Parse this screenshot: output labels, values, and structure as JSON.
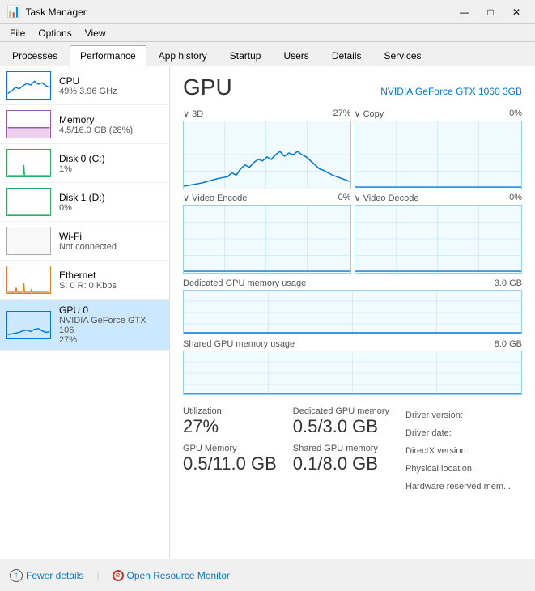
{
  "titleBar": {
    "title": "Task Manager",
    "minimize": "—",
    "maximize": "□",
    "close": "✕"
  },
  "menuBar": {
    "items": [
      "File",
      "Options",
      "View"
    ]
  },
  "tabs": {
    "items": [
      "Processes",
      "Performance",
      "App history",
      "Startup",
      "Users",
      "Details",
      "Services"
    ],
    "active": "Performance"
  },
  "sidebar": {
    "items": [
      {
        "id": "cpu",
        "name": "CPU",
        "detail": "49% 3.96 GHz",
        "color": "#0078d7"
      },
      {
        "id": "memory",
        "name": "Memory",
        "detail": "4.5/16.0 GB (28%)",
        "color": "#9b59b6"
      },
      {
        "id": "disk0",
        "name": "Disk 0 (C:)",
        "detail": "1%",
        "color": "#27ae60"
      },
      {
        "id": "disk1",
        "name": "Disk 1 (D:)",
        "detail": "0%",
        "color": "#27ae60"
      },
      {
        "id": "wifi",
        "name": "Wi-Fi",
        "detail": "Not connected",
        "color": "#aaa"
      },
      {
        "id": "ethernet",
        "name": "Ethernet",
        "detail": "S: 0 R: 0 Kbps",
        "color": "#e67e22"
      },
      {
        "id": "gpu0",
        "name": "GPU 0",
        "detail": "NVIDIA GeForce GTX 106",
        "detail2": "27%",
        "color": "#0078d7",
        "active": true
      }
    ]
  },
  "main": {
    "title": "GPU",
    "model": "NVIDIA GeForce GTX 1060 3GB",
    "charts": {
      "row1": [
        {
          "label": "3D",
          "value": "27%",
          "arrow": "∨"
        },
        {
          "label": "Copy",
          "value": "0%",
          "arrow": "∨"
        }
      ],
      "row2": [
        {
          "label": "Video Encode",
          "value": "0%",
          "arrow": "∨"
        },
        {
          "label": "Video Decode",
          "value": "0%",
          "arrow": "∨"
        }
      ]
    },
    "memoryBars": [
      {
        "label": "Dedicated GPU memory usage",
        "value": "3.0 GB"
      },
      {
        "label": "Shared GPU memory usage",
        "value": "8.0 GB"
      }
    ],
    "stats": {
      "left": [
        {
          "label": "Utilization",
          "value": "27%"
        },
        {
          "label": "GPU Memory",
          "value": "0.5/11.0 GB"
        }
      ],
      "middle": [
        {
          "label": "Dedicated GPU memory",
          "value": "0.5/3.0 GB"
        },
        {
          "label": "Shared GPU memory",
          "value": "0.1/8.0 GB"
        }
      ],
      "right": [
        "Driver version:",
        "Driver date:",
        "DirectX version:",
        "Physical location:",
        "Hardware reserved mem..."
      ]
    }
  },
  "bottomBar": {
    "fewerDetails": "Fewer details",
    "openResourceMonitor": "Open Resource Monitor"
  }
}
